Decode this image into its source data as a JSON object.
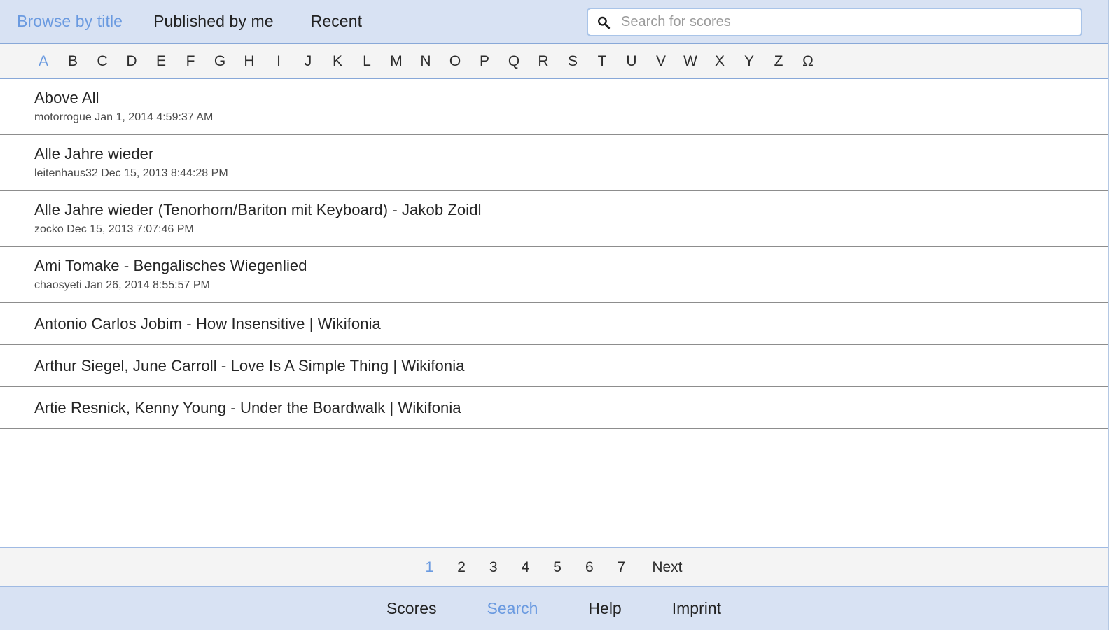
{
  "topbar": {
    "tabs": [
      {
        "label": "Browse by title",
        "active": true
      },
      {
        "label": "Published by me",
        "active": false
      },
      {
        "label": "Recent",
        "active": false
      }
    ],
    "search": {
      "icon": "search-icon",
      "placeholder": "Search for scores",
      "value": ""
    }
  },
  "alphabet": {
    "letters": [
      "A",
      "B",
      "C",
      "D",
      "E",
      "F",
      "G",
      "H",
      "I",
      "J",
      "K",
      "L",
      "M",
      "N",
      "O",
      "P",
      "Q",
      "R",
      "S",
      "T",
      "U",
      "V",
      "W",
      "X",
      "Y",
      "Z",
      "Ω"
    ],
    "active": "A"
  },
  "list": {
    "items": [
      {
        "title": "Above All",
        "meta": "motorrogue Jan 1, 2014 4:59:37 AM"
      },
      {
        "title": "Alle Jahre wieder",
        "meta": "leitenhaus32 Dec 15, 2013 8:44:28 PM"
      },
      {
        "title": "Alle Jahre wieder (Tenorhorn/Bariton mit Keyboard) - Jakob Zoidl",
        "meta": "zocko Dec 15, 2013 7:07:46 PM"
      },
      {
        "title": "Ami Tomake - Bengalisches Wiegenlied",
        "meta": "chaosyeti Jan 26, 2014 8:55:57 PM"
      },
      {
        "title": "Antonio Carlos Jobim - How Insensitive | Wikifonia",
        "meta": ""
      },
      {
        "title": "Arthur Siegel, June Carroll - Love Is A Simple Thing | Wikifonia",
        "meta": ""
      },
      {
        "title": "Artie Resnick, Kenny Young - Under the Boardwalk | Wikifonia",
        "meta": ""
      }
    ]
  },
  "pagination": {
    "pages": [
      "1",
      "2",
      "3",
      "4",
      "5",
      "6",
      "7"
    ],
    "current": "1",
    "next_label": "Next"
  },
  "footer": {
    "links": [
      {
        "label": "Scores",
        "active": false
      },
      {
        "label": "Search",
        "active": true
      },
      {
        "label": "Help",
        "active": false
      },
      {
        "label": "Imprint",
        "active": false
      }
    ]
  },
  "colors": {
    "accent": "#6a9ae0",
    "header_bg": "#d8e2f3",
    "bar_bg": "#f4f4f4",
    "border_blue": "#88a8d8",
    "text": "#222222",
    "divider": "#8d8d8d"
  }
}
